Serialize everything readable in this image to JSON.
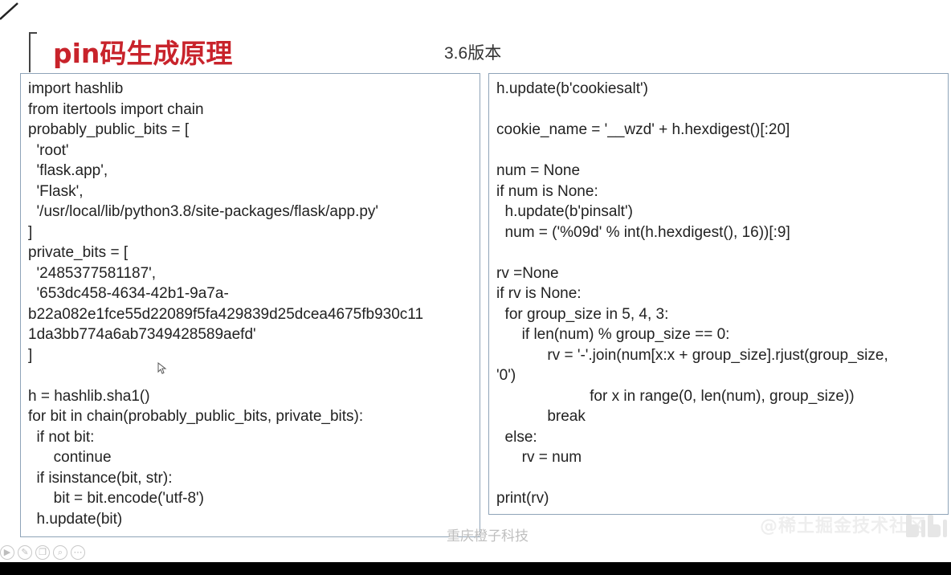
{
  "slide": {
    "title": "pin码生成原理",
    "version": "3.6版本"
  },
  "left_code": [
    "import hashlib",
    "from itertools import chain",
    "probably_public_bits = [",
    "  'root'",
    "  'flask.app',",
    "  'Flask',",
    "  '/usr/local/lib/python3.8/site-packages/flask/app.py'",
    "]",
    "private_bits = [",
    "  '2485377581187',",
    "  '653dc458-4634-42b1-9a7a-",
    "b22a082e1fce55d22089f5fa429839d25dcea4675fb930c11",
    "1da3bb774a6ab7349428589aefd'",
    "]",
    "",
    "h = hashlib.sha1()",
    "for bit in chain(probably_public_bits, private_bits):",
    "  if not bit:",
    "      continue",
    "  if isinstance(bit, str):",
    "      bit = bit.encode('utf-8')",
    "  h.update(bit)"
  ],
  "right_code": [
    "h.update(b'cookiesalt')",
    "",
    "cookie_name = '__wzd' + h.hexdigest()[:20]",
    "",
    "num = None",
    "if num is None:",
    "  h.update(b'pinsalt')",
    "  num = ('%09d' % int(h.hexdigest(), 16))[:9]",
    "",
    "rv =None",
    "if rv is None:",
    "  for group_size in 5, 4, 3:",
    "      if len(num) % group_size == 0:",
    "            rv = '-'.join(num[x:x + group_size].rjust(group_size,",
    "'0')",
    "                      for x in range(0, len(num), group_size))",
    "            break",
    "  else:",
    "      rv = num",
    "",
    "print(rv)"
  ],
  "watermark": {
    "center": "重庆橙子科技",
    "right": "@稀土掘金技术社区"
  },
  "toolbar_icons": [
    "play-icon",
    "pen-icon",
    "copy-icon",
    "zoom-icon",
    "more-icon"
  ],
  "colors": {
    "title": "#c8232b",
    "box_border": "#8fa4b8",
    "code_text": "#222222"
  }
}
